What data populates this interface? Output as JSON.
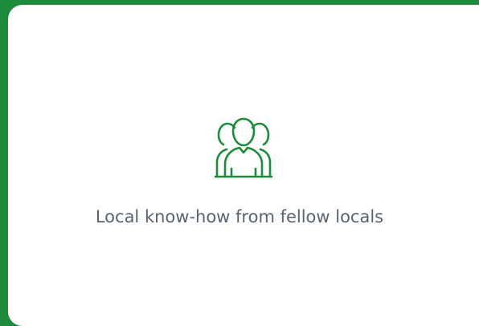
{
  "card": {
    "icon": "people-group-icon",
    "caption": "Local know-how from fellow locals"
  },
  "colors": {
    "frame": "#1e8a3c",
    "icon": "#1e8a3c",
    "caption": "#5b6270",
    "card": "#ffffff"
  }
}
